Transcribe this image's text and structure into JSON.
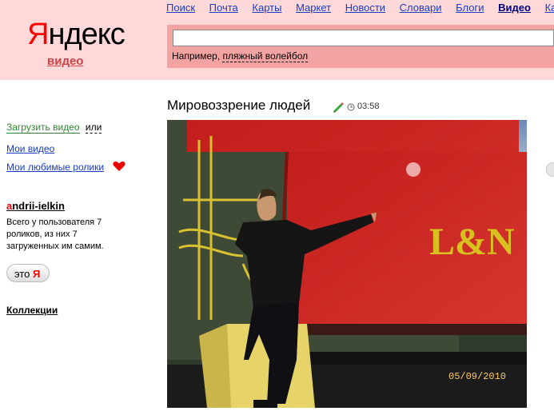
{
  "header": {
    "logo_first_letter": "Я",
    "logo_rest": "ндекс",
    "section": "видео",
    "nav": [
      "Поиск",
      "Почта",
      "Карты",
      "Маркет",
      "Новости",
      "Словари",
      "Блоги",
      "Видео",
      "Картин"
    ],
    "active_nav": "Видео",
    "search": {
      "value": "",
      "hint_prefix": "Например, ",
      "hint_example": "пляжный волейбол"
    }
  },
  "sidebar": {
    "upload_label": "Загрузить видео",
    "or_label": "или",
    "my_videos": "Мои видео",
    "favorites": "Мои любимые ролики",
    "user_first_letter": "a",
    "user_rest": "ndrii-ielkin",
    "user_info": "Всего у пользователя 7 роликов, из них 7 загруженных им самим.",
    "eto_button": "это",
    "eto_icon_glyph": "Я",
    "collections": "Коллекции"
  },
  "video": {
    "title": "Мировоззрение людей",
    "duration": "03:58",
    "date_stamp": "05/09/2010",
    "railcar_logo": "L&N"
  },
  "colors": {
    "header_bg": "#ffd9d9",
    "search_band": "#f4a3a3",
    "link": "#1a3dc1",
    "brand_red": "#ff0000"
  }
}
